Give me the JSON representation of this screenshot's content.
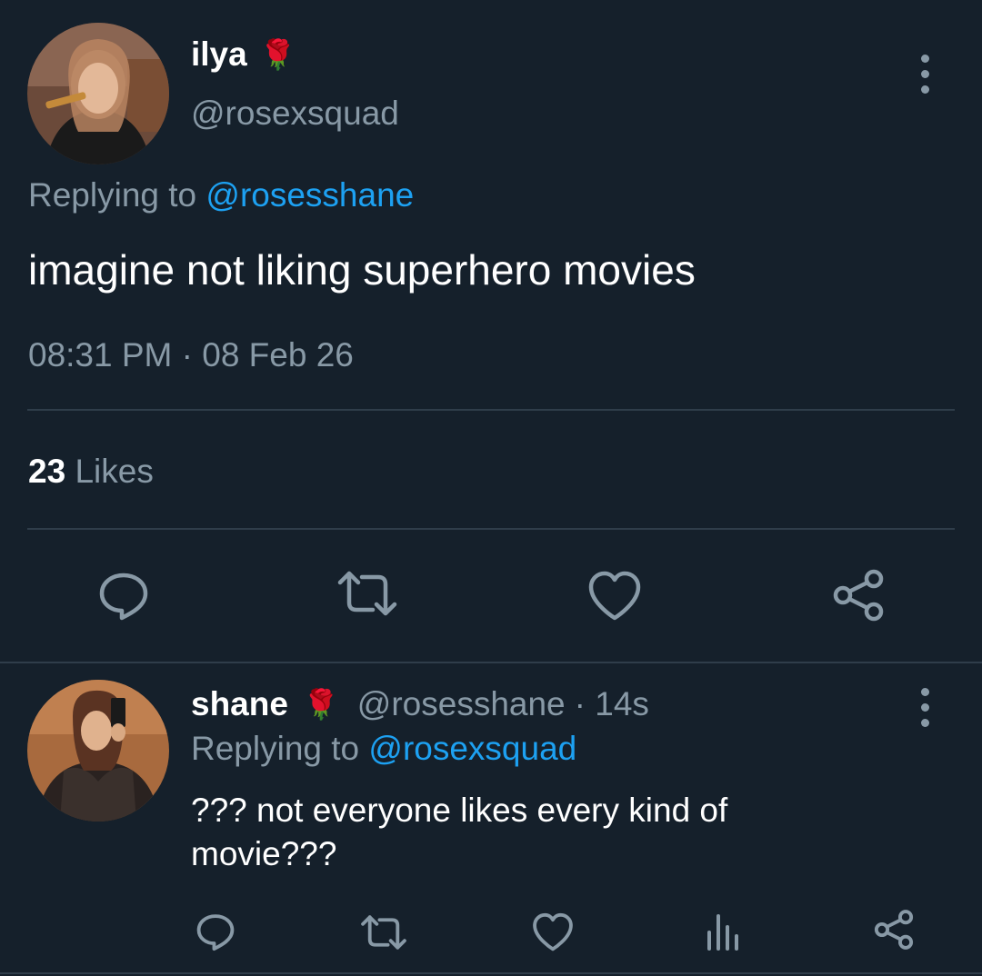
{
  "main_tweet": {
    "author_name": "ilya",
    "author_emoji": "🌹",
    "author_handle": "@rosexsquad",
    "replying_prefix": "Replying to",
    "replying_to": "@rosesshane",
    "text": "imagine not liking superhero movies",
    "timestamp": "08:31 PM · 08 Feb 26",
    "likes_count": "23",
    "likes_label": "Likes"
  },
  "reply": {
    "author_name": "shane",
    "author_emoji": "🌹",
    "author_handle": "@rosesshane",
    "time_ago": "· 14s",
    "replying_prefix": "Replying to",
    "replying_to": "@rosexsquad",
    "text_line1": "??? not everyone likes every kind of",
    "text_line2": "movie???"
  },
  "icons": {
    "main_actions": [
      "reply-icon",
      "retweet-icon",
      "like-icon",
      "share-icon"
    ],
    "reply_actions": [
      "reply-icon",
      "retweet-icon",
      "like-icon",
      "analytics-icon",
      "share-icon"
    ],
    "more_options": "more-options-icon"
  },
  "colors": {
    "background": "#15202b",
    "text": "#ffffff",
    "muted": "#8899a6",
    "link": "#1da1f2",
    "divider": "#2f3d4a"
  }
}
